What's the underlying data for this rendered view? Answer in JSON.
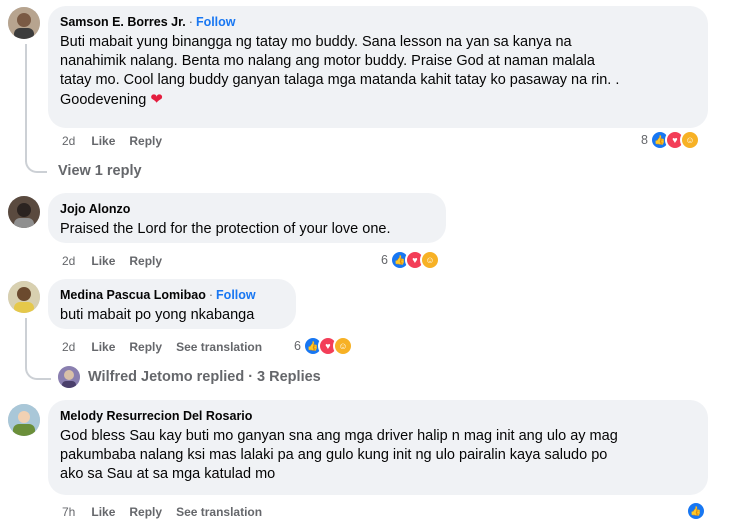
{
  "comments": [
    {
      "author": "Samson E. Borres Jr.",
      "follow": "Follow",
      "text_lines": [
        "Buti mabait yung binangga ng tatay mo buddy. Sana lesson na yan sa kanya na",
        "nanahimik nalang. Benta mo nalang ang motor buddy. Praise God at naman malala",
        "tatay mo. Cool lang buddy ganyan talaga mga matanda kahit tatay ko pasaway na rin. .",
        "Goodevening"
      ],
      "emoji": "❤",
      "time": "2d",
      "like": "Like",
      "reply": "Reply",
      "reaction_count": "8",
      "view_replies": "View 1 reply"
    },
    {
      "author": "Jojo Alonzo",
      "text_lines": [
        "Praised the Lord for the protection of your love one."
      ],
      "time": "2d",
      "like": "Like",
      "reply": "Reply",
      "reaction_count": "6"
    },
    {
      "author": "Medina Pascua Lomibao",
      "follow": "Follow",
      "text_lines": [
        "buti mabait po yong nkabanga"
      ],
      "time": "2d",
      "like": "Like",
      "reply": "Reply",
      "see_translation": "See translation",
      "reaction_count": "6",
      "replied_summary": "Wilfred Jetomo replied · 3 Replies"
    },
    {
      "author": "Melody Resurrecion Del Rosario",
      "text_lines": [
        "God bless Sau kay buti mo ganyan sna ang mga driver halip n mag init ang ulo ay mag",
        "pakumbaba nalang ksi mas lalaki pa ang gulo kung init ng ulo pairalin kaya saludo po",
        "ako sa Sau at sa mga katulad mo"
      ],
      "time": "7h",
      "like": "Like",
      "reply": "Reply",
      "see_translation": "See translation"
    }
  ],
  "colors": {
    "accent": "#1877f2",
    "love": "#f33e58",
    "care": "#f7b125",
    "bubble": "#f0f2f5",
    "muted": "#65676b"
  }
}
